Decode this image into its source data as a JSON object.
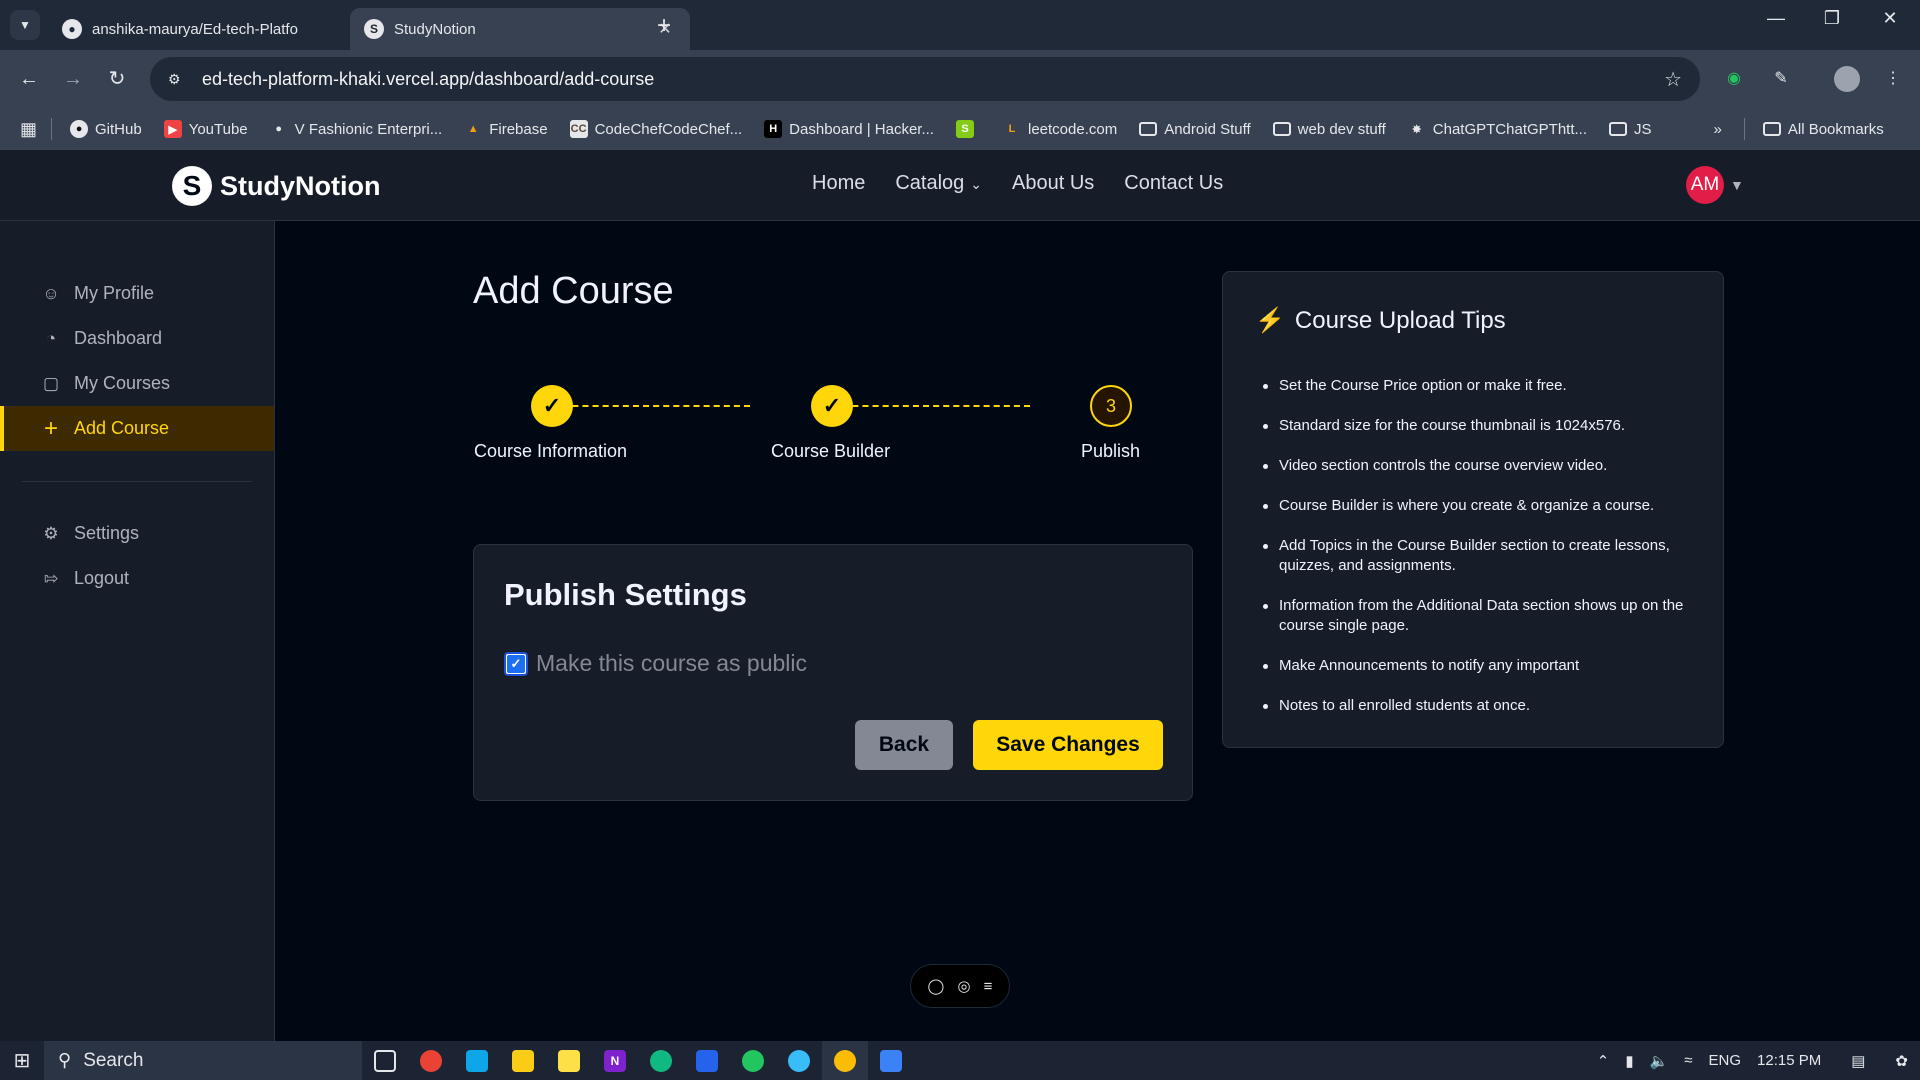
{
  "browser": {
    "tabs": [
      {
        "title": "anshika-maurya/Ed-tech-Platfo",
        "favicon": "github-icon"
      },
      {
        "title": "StudyNotion",
        "favicon": "studynotion-icon"
      }
    ],
    "url": "ed-tech-platform-khaki.vercel.app/dashboard/add-course",
    "bookmarks": [
      {
        "label": "GitHub",
        "icon": "github-icon"
      },
      {
        "label": "YouTube",
        "icon": "youtube-icon"
      },
      {
        "label": "V Fashionic Enterpri...",
        "icon": "globe-icon"
      },
      {
        "label": "Firebase",
        "icon": "firebase-icon"
      },
      {
        "label": "CodeChefCodeChef...",
        "icon": "codechef-icon"
      },
      {
        "label": "Dashboard | Hacker...",
        "icon": "hackerrank-icon"
      },
      {
        "label": "",
        "icon": "shopify-icon"
      },
      {
        "label": "leetcode.com",
        "icon": "leetcode-icon"
      },
      {
        "label": "Android Stuff",
        "icon": "folder-icon"
      },
      {
        "label": "web dev stuff",
        "icon": "folder-icon"
      },
      {
        "label": "ChatGPTChatGPThtt...",
        "icon": "chatgpt-icon"
      },
      {
        "label": "JS",
        "icon": "folder-icon"
      }
    ],
    "all_bookmarks": "All Bookmarks"
  },
  "app": {
    "logo_text": "StudyNotion",
    "nav": {
      "home": "Home",
      "catalog": "Catalog",
      "about": "About Us",
      "contact": "Contact Us"
    },
    "avatar_initials": "AM"
  },
  "sidebar": {
    "items": [
      {
        "label": "My Profile",
        "icon": "user-icon"
      },
      {
        "label": "Dashboard",
        "icon": "dashboard-icon"
      },
      {
        "label": "My Courses",
        "icon": "monitor-icon"
      },
      {
        "label": "Add Course",
        "icon": "plus-icon",
        "active": true
      }
    ],
    "bottom_items": [
      {
        "label": "Settings",
        "icon": "gear-icon"
      },
      {
        "label": "Logout",
        "icon": "logout-icon"
      }
    ]
  },
  "main": {
    "title": "Add Course",
    "steps": [
      {
        "label": "Course Information",
        "state": "done"
      },
      {
        "label": "Course Builder",
        "state": "done"
      },
      {
        "label": "Publish",
        "state": "current",
        "number": "3"
      }
    ],
    "publish": {
      "title": "Publish Settings",
      "checkbox_label": "Make this course as public",
      "checked": true,
      "back_label": "Back",
      "save_label": "Save Changes"
    },
    "tips": {
      "title": "Course Upload Tips",
      "items": [
        "Set the Course Price option or make it free.",
        "Standard size for the course thumbnail is 1024x576.",
        "Video section controls the course overview video.",
        "Course Builder is where you create & organize a course.",
        "Add Topics in the Course Builder section to create lessons, quizzes, and assignments.",
        "Information from the Additional Data section shows up on the course single page.",
        "Make Announcements to notify any important",
        "Notes to all enrolled students at once."
      ]
    }
  },
  "taskbar": {
    "search_label": "Search",
    "language": "ENG",
    "time": "12:15 PM"
  },
  "colors": {
    "accent": "#FFD60A",
    "background": "#000814",
    "panel": "#161D29",
    "avatar": "#e11d48"
  }
}
